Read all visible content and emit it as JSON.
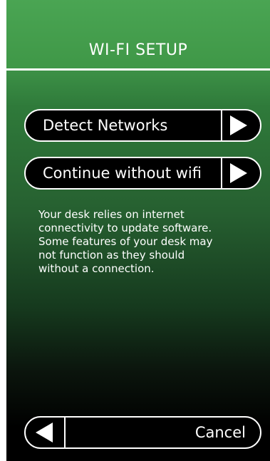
{
  "header": {
    "title": "WI-FI SETUP"
  },
  "buttons": {
    "detect_networks": {
      "label": "Detect Networks",
      "icon": "arrow-right-icon"
    },
    "continue_without_wifi": {
      "label": "Continue without wifi",
      "icon": "arrow-right-icon"
    },
    "cancel": {
      "label": "Cancel",
      "icon": "arrow-left-icon"
    }
  },
  "info": {
    "lines": [
      "Your desk relies on internet",
      "connectivity to update software.",
      "Some features of your desk may",
      "not function as they should",
      "without a connection."
    ]
  },
  "colors": {
    "header_green": "#4aa553",
    "button_bg": "#000000",
    "button_border": "#ffffff",
    "text": "#ffffff"
  }
}
